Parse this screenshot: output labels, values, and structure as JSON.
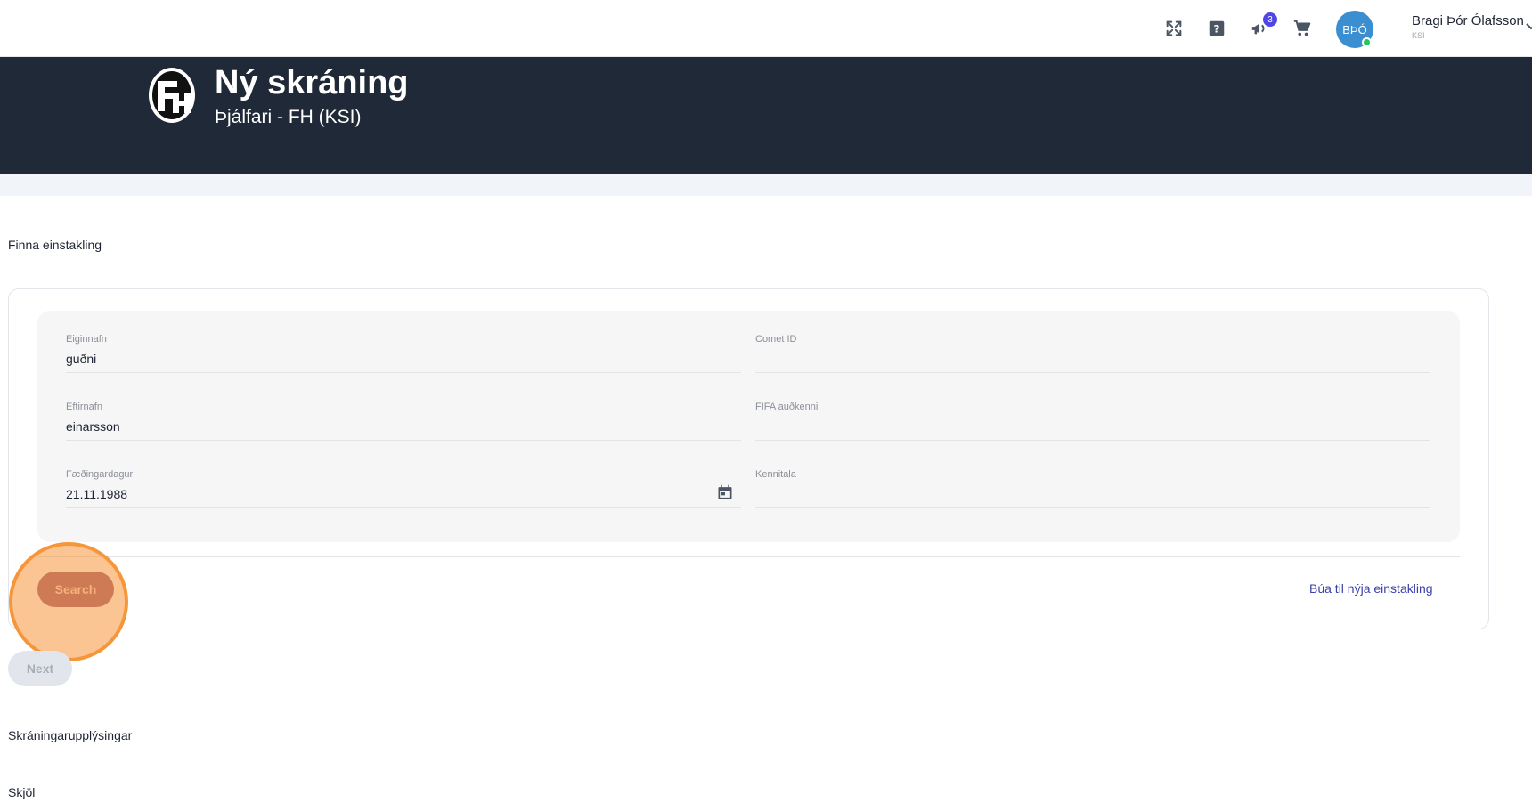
{
  "topbar": {
    "icons": [
      "fullscreen-icon",
      "help-icon",
      "megaphone-icon",
      "cart-icon"
    ],
    "notification_count": "3",
    "avatar_initials": "BÞÓ",
    "user_name": "Bragi Þór Ólafsson",
    "user_org": "KSI"
  },
  "header": {
    "title": "Ný skráning",
    "subtitle": "Þjálfari - FH (KSI)"
  },
  "sections": {
    "find_person": "Finna einstakling",
    "registration_info": "Skráningarupplýsingar",
    "documents": "Skjöl"
  },
  "form": {
    "first_name": {
      "label": "Eiginnafn",
      "value": "guðni"
    },
    "comet_id": {
      "label": "Comet ID",
      "value": ""
    },
    "last_name": {
      "label": "Eftirnafn",
      "value": "einarsson"
    },
    "fifa_id": {
      "label": "FIFA auðkenni",
      "value": ""
    },
    "birth_date": {
      "label": "Fæðingardagur",
      "value": "21.11.1988"
    },
    "kennitala": {
      "label": "Kennitala",
      "value": ""
    }
  },
  "actions": {
    "search_label": "Search",
    "create_label": "Búa til nýja einstakling",
    "next_label": "Next"
  },
  "colors": {
    "header_bg": "#1f2937",
    "search_button": "#9c5a75",
    "highlight": "#f5963a",
    "link": "#3b3fa8",
    "badge": "#4f46e5"
  }
}
